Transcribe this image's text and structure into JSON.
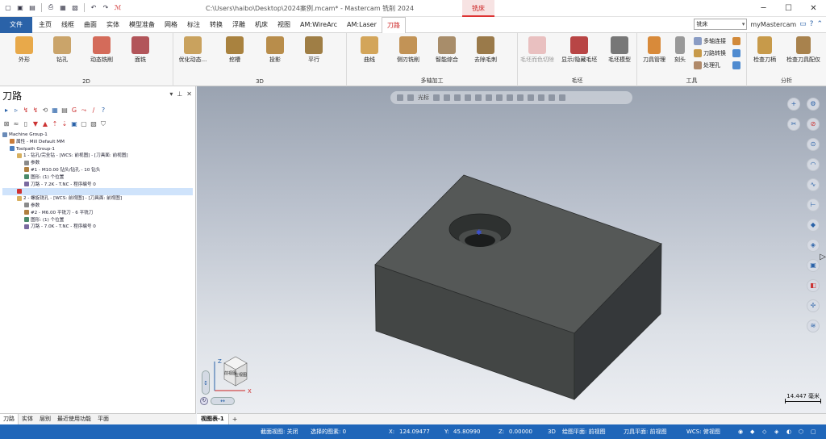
{
  "window": {
    "title": "C:\\Users\\haibo\\Desktop\\2024案例.mcam* - Mastercam 铣削 2024",
    "context_tab_group": "铣床"
  },
  "quick_access": [
    "new-icon",
    "save-icon",
    "open-icon",
    "print-icon",
    "save-as-icon",
    "undo-icon",
    "redo-icon",
    "mastercam-icon"
  ],
  "tabs": {
    "file": "文件",
    "items": [
      "主页",
      "线框",
      "曲面",
      "实体",
      "模型准备",
      "网格",
      "标注",
      "转换",
      "浮雕",
      "机床",
      "视图",
      "AM:WireArc",
      "AM:Laser",
      "刀路"
    ],
    "active": "刀路"
  },
  "top_right": {
    "mode_combo": "铣床",
    "my_mastercam": "myMastercam"
  },
  "ribbon": {
    "g2d": {
      "label": "2D",
      "buttons": [
        "外形",
        "钻孔",
        "动态铣削",
        "面铣"
      ]
    },
    "g3d": {
      "label": "3D",
      "buttons": [
        "优化动态...",
        "挖槽",
        "投影",
        "平行"
      ]
    },
    "gmulti": {
      "label": "多轴加工",
      "buttons": [
        "曲线",
        "侧刃铣削",
        "智能综合",
        "去除毛刺"
      ]
    },
    "gstock": {
      "label": "毛坯",
      "buttons": [
        "毛坯而色切除",
        "显示/隐藏毛坯",
        "毛坯模型"
      ]
    },
    "gtool": {
      "label": "工具",
      "big": [
        "刀具管理",
        "刻头"
      ],
      "small": [
        "多轴连接",
        "刀路转换",
        "处理孔"
      ]
    },
    "ganalysis": {
      "label": "分析",
      "buttons": [
        "检查刀柄",
        "检查刀具配仅"
      ]
    }
  },
  "left_panel": {
    "title": "刀路",
    "tree": [
      {
        "text": "Machine Group-1",
        "level": 0,
        "icon": "machine-group-icon",
        "sel": false
      },
      {
        "text": "属性 - Mill Default MM",
        "level": 1,
        "icon": "properties-icon",
        "sel": false
      },
      {
        "text": "Toolpath Group-1",
        "level": 1,
        "icon": "toolpath-group-icon",
        "sel": false
      },
      {
        "text": "1 - 钻孔/完全钻 - [WCS: 前视图] - [刀具面: 前视图]",
        "level": 2,
        "icon": "operation-folder-icon",
        "sel": false
      },
      {
        "text": "参数",
        "level": 3,
        "icon": "parameters-icon",
        "sel": false
      },
      {
        "text": "#1 - M10.00 钻头/钻孔 - 10 钻头",
        "level": 3,
        "icon": "tool-icon",
        "sel": false
      },
      {
        "text": "图形: (1) 个位置",
        "level": 3,
        "icon": "geometry-icon",
        "sel": false
      },
      {
        "text": "刀路 - 7.2K - T.NC - 程序编号 0",
        "level": 3,
        "icon": "toolpath-file-icon",
        "sel": false
      },
      {
        "text": "",
        "level": 2,
        "icon": "insert-arrow-icon",
        "sel": true
      },
      {
        "text": "2 - 螺旋铣孔 - [WCS: 前视图] - [刀具面: 前视图]",
        "level": 2,
        "icon": "operation-folder-icon",
        "sel": false
      },
      {
        "text": "参数",
        "level": 3,
        "icon": "parameters-icon",
        "sel": false
      },
      {
        "text": "#2 - M6.00 平铣刀 - 6 平铣刀",
        "level": 3,
        "icon": "tool-icon",
        "sel": false
      },
      {
        "text": "图形: (1) 个位置",
        "level": 3,
        "icon": "geometry-icon",
        "sel": false
      },
      {
        "text": "刀路 - 7.0K - T.NC - 程序编号 0",
        "level": 3,
        "icon": "toolpath-file-icon",
        "sel": false
      }
    ],
    "footer_tabs": [
      "刀路",
      "实体",
      "层别",
      "最近使用功能",
      "平面"
    ]
  },
  "viewport": {
    "toolbar_label": "光标",
    "scale_text": "14.447 毫米",
    "cube_face_top": "前视图",
    "cube_face_side": "左视图",
    "view_tab": "视图表-1",
    "add_tab": "+"
  },
  "status": {
    "section": "截面视图: 关闭",
    "selected": "选择的图素: 0",
    "x_label": "X:",
    "x": "124.09477",
    "y_label": "Y:",
    "y": "45.80990",
    "z_label": "Z:",
    "z": "0.00000",
    "mode": "3D",
    "draw_plane": "绘图平面: 前视图",
    "tool_plane": "刀具平面: 前视图",
    "wcs": "WCS: 俯视图"
  },
  "colors": {
    "accent": "#1f66b9",
    "context_red": "#cc2222",
    "solid_top": "#545756",
    "solid_front": "#3f4241",
    "solid_right": "#323534"
  }
}
